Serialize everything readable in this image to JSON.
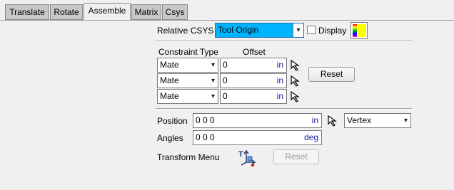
{
  "tabs": [
    {
      "label": "Translate",
      "active": false
    },
    {
      "label": "Rotate",
      "active": false
    },
    {
      "label": "Assemble",
      "active": true
    },
    {
      "label": "Matrix",
      "active": false
    },
    {
      "label": "Csys",
      "active": false
    }
  ],
  "relative_csys": {
    "label": "Relative CSYS",
    "value": "Tool Origin",
    "highlight_color": "#00b4ff",
    "display_label": "Display",
    "display_checked": false,
    "color_swatch": "#ffff00"
  },
  "constraints": {
    "type_header": "Constraint Type",
    "offset_header": "Offset",
    "rows": [
      {
        "type": "Mate",
        "offset": "0",
        "unit": "in"
      },
      {
        "type": "Mate",
        "offset": "0",
        "unit": "in"
      },
      {
        "type": "Mate",
        "offset": "0",
        "unit": "in"
      }
    ],
    "reset_label": "Reset"
  },
  "position": {
    "label": "Position",
    "value": "0 0 0",
    "unit": "in",
    "snap_mode": "Vertex"
  },
  "angles": {
    "label": "Angles",
    "value": "0 0 0",
    "unit": "deg"
  },
  "transform_menu": {
    "label": "Transform Menu",
    "reset_label": "Reset"
  },
  "colors": {
    "unit_text": "#2020a0",
    "accent": "#00b4ff"
  }
}
